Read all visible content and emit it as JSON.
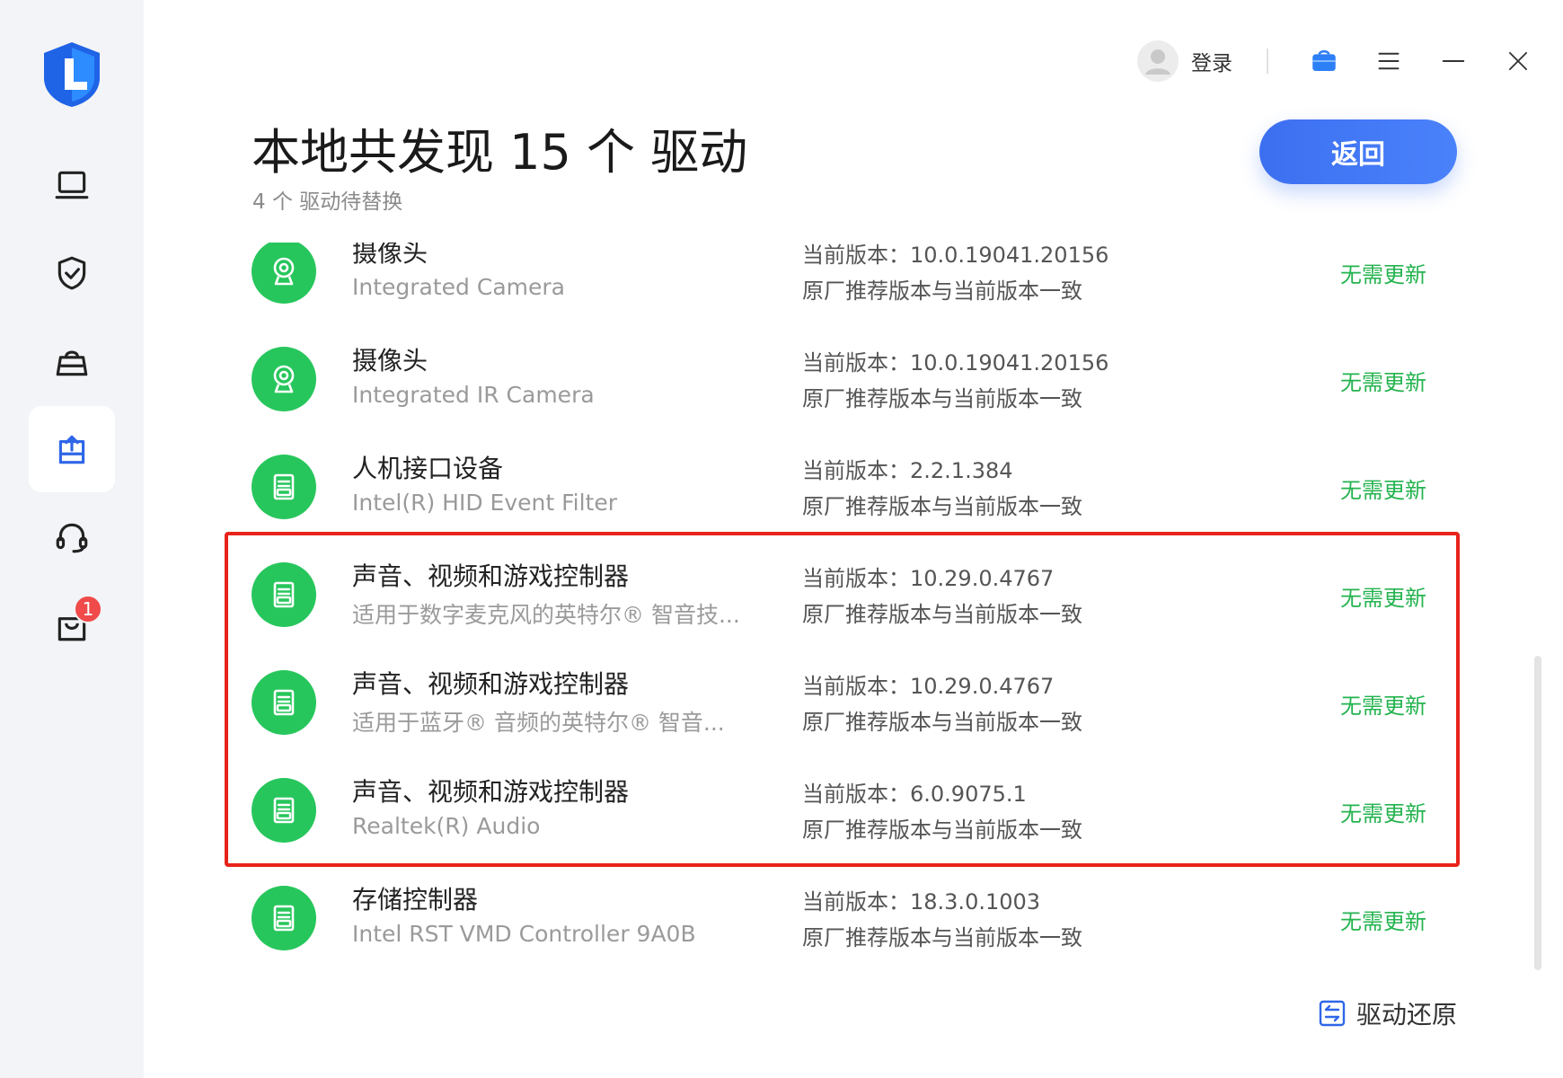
{
  "header": {
    "login_label": "登录"
  },
  "page": {
    "title": "本地共发现 15 个 驱动",
    "subtitle": "4 个 驱动待替换",
    "back_label": "返回"
  },
  "drivers": [
    {
      "name": "摄像头",
      "model": "Integrated Camera",
      "version": "当前版本：10.0.19041.20156",
      "note": "原厂推荐版本与当前版本一致",
      "status": "无需更新",
      "icon": "webcam-icon"
    },
    {
      "name": "摄像头",
      "model": "Integrated IR Camera",
      "version": "当前版本：10.0.19041.20156",
      "note": "原厂推荐版本与当前版本一致",
      "status": "无需更新",
      "icon": "webcam-icon"
    },
    {
      "name": "人机接口设备",
      "model": "Intel(R) HID Event Filter",
      "version": "当前版本：2.2.1.384",
      "note": "原厂推荐版本与当前版本一致",
      "status": "无需更新",
      "icon": "driver-icon"
    },
    {
      "name": "声音、视频和游戏控制器",
      "model": "适用于数字麦克风的英特尔® 智音技...",
      "version": "当前版本：10.29.0.4767",
      "note": "原厂推荐版本与当前版本一致",
      "status": "无需更新",
      "icon": "driver-icon"
    },
    {
      "name": "声音、视频和游戏控制器",
      "model": "适用于蓝牙® 音频的英特尔® 智音...",
      "version": "当前版本：10.29.0.4767",
      "note": "原厂推荐版本与当前版本一致",
      "status": "无需更新",
      "icon": "driver-icon"
    },
    {
      "name": "声音、视频和游戏控制器",
      "model": "Realtek(R) Audio",
      "version": "当前版本：6.0.9075.1",
      "note": "原厂推荐版本与当前版本一致",
      "status": "无需更新",
      "icon": "driver-icon"
    },
    {
      "name": "存储控制器",
      "model": "Intel RST VMD Controller 9A0B",
      "version": "当前版本：18.3.0.1003",
      "note": "原厂推荐版本与当前版本一致",
      "status": "无需更新",
      "icon": "driver-icon"
    }
  ],
  "footer": {
    "restore_label": "驱动还原"
  },
  "sidebar": {
    "badge_count": "1",
    "items": [
      "laptop-icon",
      "shield-check-icon",
      "toolbox-icon",
      "driver-upload-icon",
      "headset-icon",
      "shopping-bag-icon"
    ]
  },
  "colors": {
    "accent": "#3c6ff0",
    "status_green": "#24b34f",
    "icon_green": "#27c65c",
    "highlight_red": "#e8231a"
  }
}
